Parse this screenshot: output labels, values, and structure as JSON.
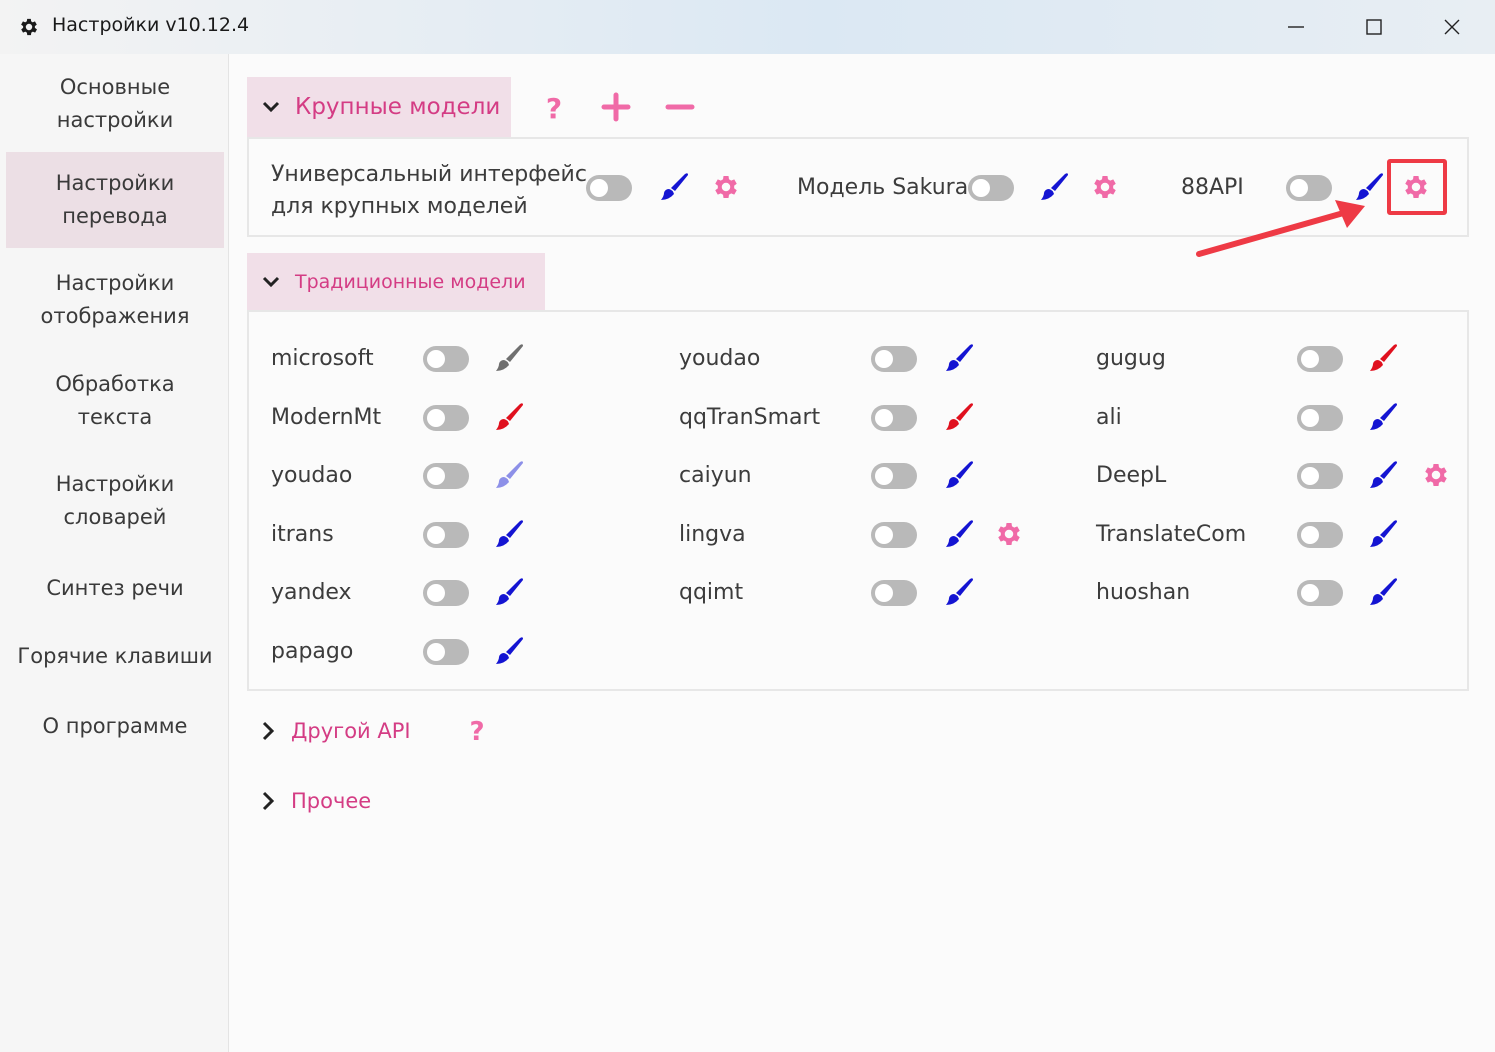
{
  "window": {
    "title": "Настройки v10.12.4",
    "icon": "gear-icon",
    "controls": [
      "minimize-icon",
      "maximize-icon",
      "close-icon"
    ]
  },
  "sidebar": {
    "items": [
      {
        "label": "Основные\nнастройки",
        "active": false
      },
      {
        "label": "Настройки\nперевода",
        "active": true
      },
      {
        "label": "Настройки\nотображения",
        "active": false
      },
      {
        "label": "Обработка\nтекста",
        "active": false
      },
      {
        "label": "Настройки\nсловарей",
        "active": false
      },
      {
        "label": "Синтез речи",
        "active": false
      },
      {
        "label": "Горячие клавиши",
        "active": false
      },
      {
        "label": "О программе",
        "active": false
      }
    ]
  },
  "colors": {
    "accent": "#d43c84",
    "gear": "#f06aa7",
    "brush_blue": "#1414d2",
    "brush_red": "#e0101e",
    "brush_gray": "#6f6f6f",
    "brush_light": "#8d90e8",
    "highlight": "#ee3a45"
  },
  "large_models": {
    "title": "Крупные модели",
    "expanded": true,
    "header_icons": [
      "question-icon",
      "plus-icon",
      "minus-icon"
    ],
    "items": [
      {
        "label": "Универсальный интерфейс\nдля крупных моделей",
        "enabled": false,
        "brush": "blue",
        "settings": true
      },
      {
        "label": "Модель Sakura",
        "enabled": false,
        "brush": "blue",
        "settings": true
      },
      {
        "label": "88API",
        "enabled": false,
        "brush": "blue",
        "settings": true,
        "highlighted": true
      }
    ]
  },
  "traditional_models": {
    "title": "Традиционные модели",
    "expanded": true,
    "items": [
      {
        "label": "microsoft",
        "enabled": false,
        "brush": "gray",
        "settings": false
      },
      {
        "label": "youdao",
        "enabled": false,
        "brush": "blue",
        "settings": false
      },
      {
        "label": "gugug",
        "enabled": false,
        "brush": "red",
        "settings": false
      },
      {
        "label": "ModernMt",
        "enabled": false,
        "brush": "red",
        "settings": false
      },
      {
        "label": "qqTranSmart",
        "enabled": false,
        "brush": "red",
        "settings": false
      },
      {
        "label": "ali",
        "enabled": false,
        "brush": "blue",
        "settings": false
      },
      {
        "label": "youdao",
        "enabled": false,
        "brush": "light",
        "settings": false
      },
      {
        "label": "caiyun",
        "enabled": false,
        "brush": "blue",
        "settings": false
      },
      {
        "label": "DeepL",
        "enabled": false,
        "brush": "blue",
        "settings": true
      },
      {
        "label": "itrans",
        "enabled": false,
        "brush": "blue",
        "settings": false
      },
      {
        "label": "lingva",
        "enabled": false,
        "brush": "blue",
        "settings": true
      },
      {
        "label": "TranslateCom",
        "enabled": false,
        "brush": "blue",
        "settings": false
      },
      {
        "label": "yandex",
        "enabled": false,
        "brush": "blue",
        "settings": false
      },
      {
        "label": "qqimt",
        "enabled": false,
        "brush": "blue",
        "settings": false
      },
      {
        "label": "huoshan",
        "enabled": false,
        "brush": "blue",
        "settings": false
      },
      {
        "label": "papago",
        "enabled": false,
        "brush": "blue",
        "settings": false
      }
    ]
  },
  "other_api": {
    "title": "Другой API",
    "expanded": false,
    "help_icon": "question-icon"
  },
  "misc": {
    "title": "Прочее",
    "expanded": false
  }
}
